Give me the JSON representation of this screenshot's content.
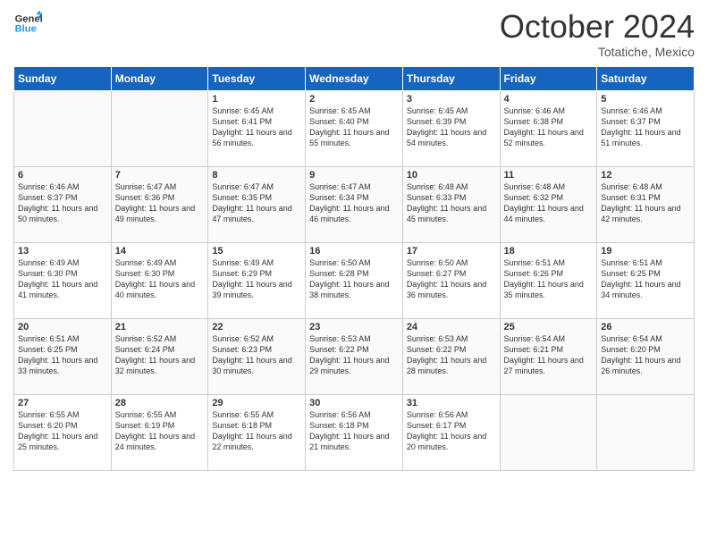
{
  "header": {
    "logo_line1": "General",
    "logo_line2": "Blue",
    "month": "October 2024",
    "location": "Totatiche, Mexico"
  },
  "columns": [
    "Sunday",
    "Monday",
    "Tuesday",
    "Wednesday",
    "Thursday",
    "Friday",
    "Saturday"
  ],
  "weeks": [
    [
      {
        "day": "",
        "sunrise": "",
        "sunset": "",
        "daylight": ""
      },
      {
        "day": "",
        "sunrise": "",
        "sunset": "",
        "daylight": ""
      },
      {
        "day": "1",
        "sunrise": "Sunrise: 6:45 AM",
        "sunset": "Sunset: 6:41 PM",
        "daylight": "Daylight: 11 hours and 56 minutes."
      },
      {
        "day": "2",
        "sunrise": "Sunrise: 6:45 AM",
        "sunset": "Sunset: 6:40 PM",
        "daylight": "Daylight: 11 hours and 55 minutes."
      },
      {
        "day": "3",
        "sunrise": "Sunrise: 6:45 AM",
        "sunset": "Sunset: 6:39 PM",
        "daylight": "Daylight: 11 hours and 54 minutes."
      },
      {
        "day": "4",
        "sunrise": "Sunrise: 6:46 AM",
        "sunset": "Sunset: 6:38 PM",
        "daylight": "Daylight: 11 hours and 52 minutes."
      },
      {
        "day": "5",
        "sunrise": "Sunrise: 6:46 AM",
        "sunset": "Sunset: 6:37 PM",
        "daylight": "Daylight: 11 hours and 51 minutes."
      }
    ],
    [
      {
        "day": "6",
        "sunrise": "Sunrise: 6:46 AM",
        "sunset": "Sunset: 6:37 PM",
        "daylight": "Daylight: 11 hours and 50 minutes."
      },
      {
        "day": "7",
        "sunrise": "Sunrise: 6:47 AM",
        "sunset": "Sunset: 6:36 PM",
        "daylight": "Daylight: 11 hours and 49 minutes."
      },
      {
        "day": "8",
        "sunrise": "Sunrise: 6:47 AM",
        "sunset": "Sunset: 6:35 PM",
        "daylight": "Daylight: 11 hours and 47 minutes."
      },
      {
        "day": "9",
        "sunrise": "Sunrise: 6:47 AM",
        "sunset": "Sunset: 6:34 PM",
        "daylight": "Daylight: 11 hours and 46 minutes."
      },
      {
        "day": "10",
        "sunrise": "Sunrise: 6:48 AM",
        "sunset": "Sunset: 6:33 PM",
        "daylight": "Daylight: 11 hours and 45 minutes."
      },
      {
        "day": "11",
        "sunrise": "Sunrise: 6:48 AM",
        "sunset": "Sunset: 6:32 PM",
        "daylight": "Daylight: 11 hours and 44 minutes."
      },
      {
        "day": "12",
        "sunrise": "Sunrise: 6:48 AM",
        "sunset": "Sunset: 6:31 PM",
        "daylight": "Daylight: 11 hours and 42 minutes."
      }
    ],
    [
      {
        "day": "13",
        "sunrise": "Sunrise: 6:49 AM",
        "sunset": "Sunset: 6:30 PM",
        "daylight": "Daylight: 11 hours and 41 minutes."
      },
      {
        "day": "14",
        "sunrise": "Sunrise: 6:49 AM",
        "sunset": "Sunset: 6:30 PM",
        "daylight": "Daylight: 11 hours and 40 minutes."
      },
      {
        "day": "15",
        "sunrise": "Sunrise: 6:49 AM",
        "sunset": "Sunset: 6:29 PM",
        "daylight": "Daylight: 11 hours and 39 minutes."
      },
      {
        "day": "16",
        "sunrise": "Sunrise: 6:50 AM",
        "sunset": "Sunset: 6:28 PM",
        "daylight": "Daylight: 11 hours and 38 minutes."
      },
      {
        "day": "17",
        "sunrise": "Sunrise: 6:50 AM",
        "sunset": "Sunset: 6:27 PM",
        "daylight": "Daylight: 11 hours and 36 minutes."
      },
      {
        "day": "18",
        "sunrise": "Sunrise: 6:51 AM",
        "sunset": "Sunset: 6:26 PM",
        "daylight": "Daylight: 11 hours and 35 minutes."
      },
      {
        "day": "19",
        "sunrise": "Sunrise: 6:51 AM",
        "sunset": "Sunset: 6:25 PM",
        "daylight": "Daylight: 11 hours and 34 minutes."
      }
    ],
    [
      {
        "day": "20",
        "sunrise": "Sunrise: 6:51 AM",
        "sunset": "Sunset: 6:25 PM",
        "daylight": "Daylight: 11 hours and 33 minutes."
      },
      {
        "day": "21",
        "sunrise": "Sunrise: 6:52 AM",
        "sunset": "Sunset: 6:24 PM",
        "daylight": "Daylight: 11 hours and 32 minutes."
      },
      {
        "day": "22",
        "sunrise": "Sunrise: 6:52 AM",
        "sunset": "Sunset: 6:23 PM",
        "daylight": "Daylight: 11 hours and 30 minutes."
      },
      {
        "day": "23",
        "sunrise": "Sunrise: 6:53 AM",
        "sunset": "Sunset: 6:22 PM",
        "daylight": "Daylight: 11 hours and 29 minutes."
      },
      {
        "day": "24",
        "sunrise": "Sunrise: 6:53 AM",
        "sunset": "Sunset: 6:22 PM",
        "daylight": "Daylight: 11 hours and 28 minutes."
      },
      {
        "day": "25",
        "sunrise": "Sunrise: 6:54 AM",
        "sunset": "Sunset: 6:21 PM",
        "daylight": "Daylight: 11 hours and 27 minutes."
      },
      {
        "day": "26",
        "sunrise": "Sunrise: 6:54 AM",
        "sunset": "Sunset: 6:20 PM",
        "daylight": "Daylight: 11 hours and 26 minutes."
      }
    ],
    [
      {
        "day": "27",
        "sunrise": "Sunrise: 6:55 AM",
        "sunset": "Sunset: 6:20 PM",
        "daylight": "Daylight: 11 hours and 25 minutes."
      },
      {
        "day": "28",
        "sunrise": "Sunrise: 6:55 AM",
        "sunset": "Sunset: 6:19 PM",
        "daylight": "Daylight: 11 hours and 24 minutes."
      },
      {
        "day": "29",
        "sunrise": "Sunrise: 6:55 AM",
        "sunset": "Sunset: 6:18 PM",
        "daylight": "Daylight: 11 hours and 22 minutes."
      },
      {
        "day": "30",
        "sunrise": "Sunrise: 6:56 AM",
        "sunset": "Sunset: 6:18 PM",
        "daylight": "Daylight: 11 hours and 21 minutes."
      },
      {
        "day": "31",
        "sunrise": "Sunrise: 6:56 AM",
        "sunset": "Sunset: 6:17 PM",
        "daylight": "Daylight: 11 hours and 20 minutes."
      },
      {
        "day": "",
        "sunrise": "",
        "sunset": "",
        "daylight": ""
      },
      {
        "day": "",
        "sunrise": "",
        "sunset": "",
        "daylight": ""
      }
    ]
  ]
}
